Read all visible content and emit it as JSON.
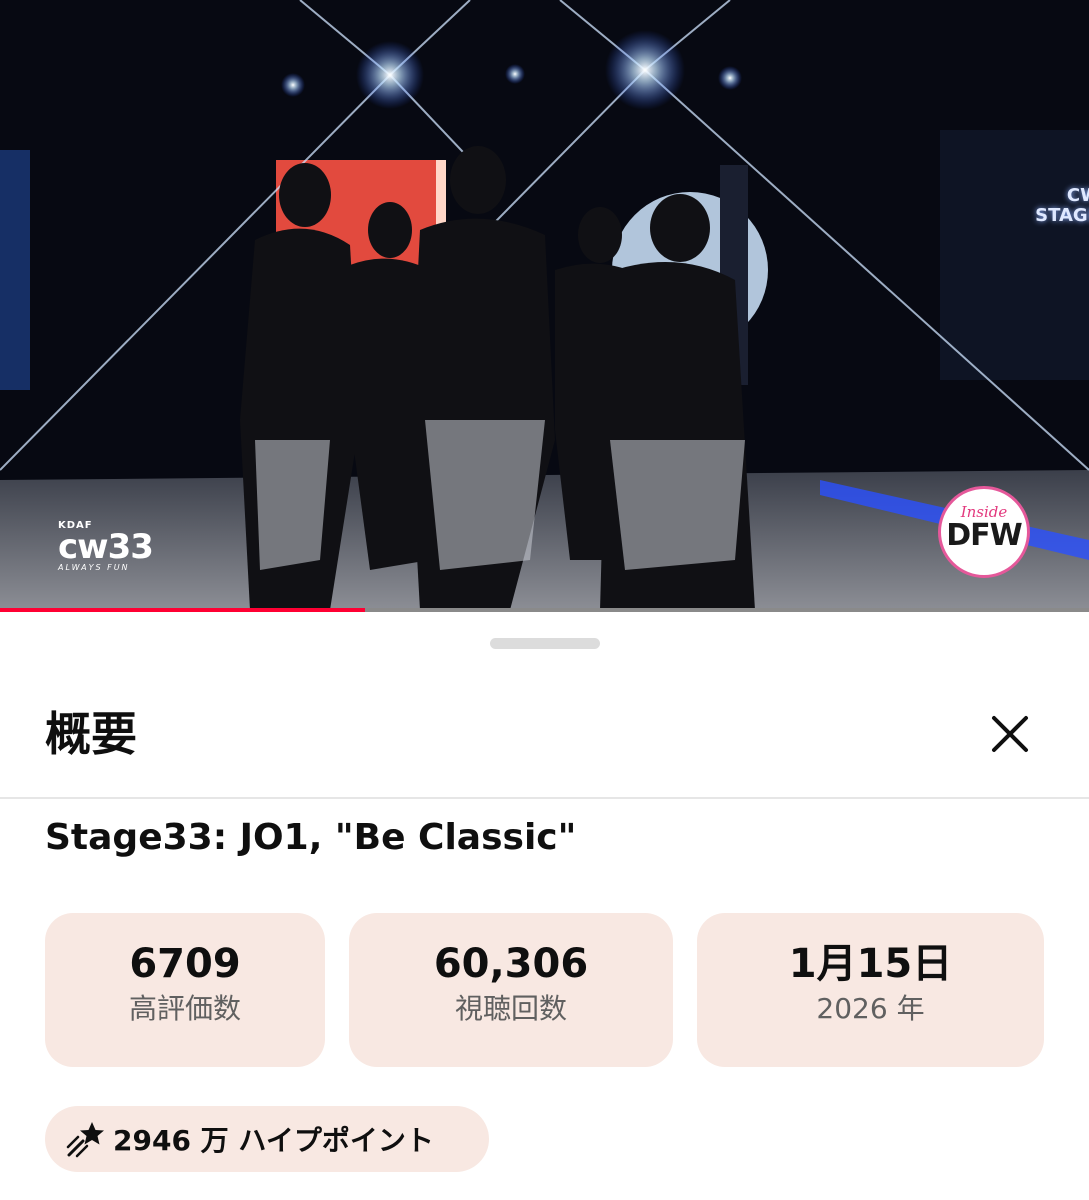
{
  "video": {
    "overlay_logo_left": {
      "small": "KDAF",
      "main": "cw33",
      "tagline": "ALWAYS FUN"
    },
    "overlay_logo_right": {
      "script": "Inside",
      "main": "DFW"
    },
    "background_sign": "CW\nSTAGE",
    "progress_fraction": 0.335,
    "colors": {
      "progress": "#ff0033"
    }
  },
  "sheet": {
    "title": "概要",
    "close_icon": "close-icon",
    "video_title": "Stage33: JO1, \"Be Classic\"",
    "stats": [
      {
        "value": "6709",
        "label": "高評価数"
      },
      {
        "value": "60,306",
        "label": "視聴回数"
      },
      {
        "value": "1月15日",
        "label": "2026 年"
      }
    ],
    "hype": {
      "icon": "hype-megaphone-icon",
      "text": "2946 万 ハイプポイント"
    },
    "colors": {
      "chip_bg": "#f8e8e2"
    }
  }
}
